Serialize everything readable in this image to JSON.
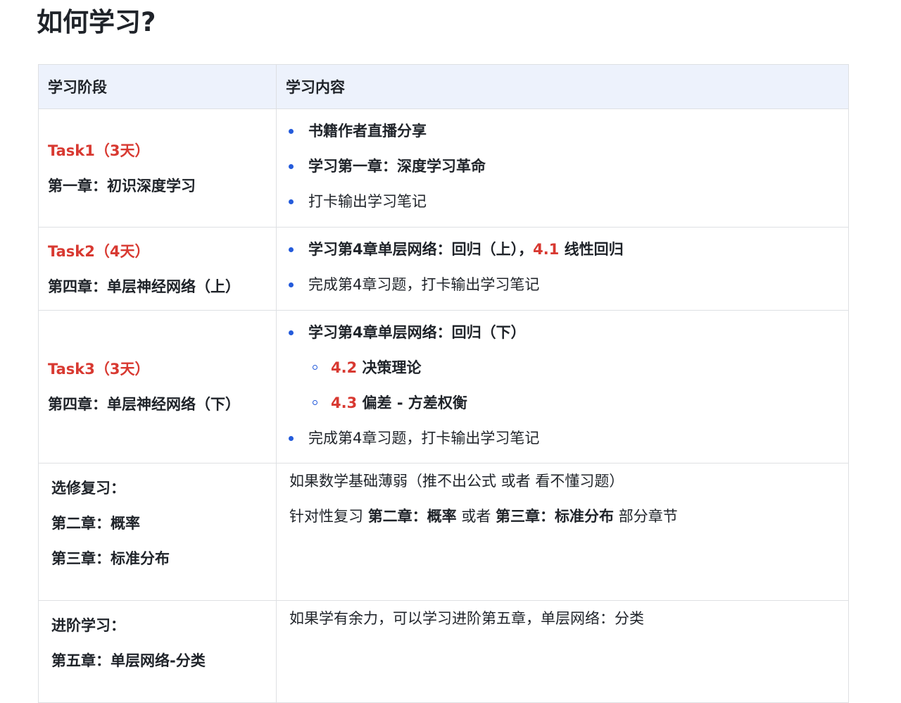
{
  "page": {
    "title": "如何学习?"
  },
  "table": {
    "headers": [
      "学习阶段",
      "学习内容"
    ],
    "rows": [
      {
        "stage": {
          "task": "Task1（3天）",
          "chapter": "第一章：初识深度学习"
        },
        "items": [
          {
            "text": "书籍作者直播分享",
            "bold": true
          },
          {
            "text": "学习第一章：深度学习革命",
            "bold": true
          },
          {
            "text": "打卡输出学习笔记",
            "bold": false
          }
        ]
      },
      {
        "stage": {
          "task": "Task2（4天）",
          "chapter": "第四章：单层神经网络（上）"
        },
        "items": [
          {
            "prefix": "学习第4章单层网络：回归（上），",
            "highlight": "4.1",
            "suffix": " 线性回归"
          },
          {
            "text": "完成第4章习题，打卡输出学习笔记",
            "bold": false
          }
        ]
      },
      {
        "stage": {
          "task": "Task3（3天）",
          "chapter": "第四章：单层神经网络（下）"
        },
        "items": [
          {
            "text": "学习第4章单层网络：回归（下）",
            "bold": true
          },
          {
            "highlight": "4.2",
            "suffix": " 决策理论",
            "sub": true
          },
          {
            "highlight": "4.3",
            "suffix": " 偏差 - 方差权衡",
            "sub": true
          },
          {
            "text": "完成第4章习题，打卡输出学习笔记",
            "bold": false
          }
        ]
      },
      {
        "stage": {
          "title": "选修复习：",
          "lines": [
            "第二章：概率",
            "第三章：标准分布"
          ]
        },
        "content": {
          "line1": "如果数学基础薄弱（推不出公式 或者 看不懂习题）",
          "line2": {
            "part1": "针对性复习 ",
            "bold1": "第二章：概率",
            "part2": " 或者 ",
            "bold2": "第三章：标准分布",
            "part3": " 部分章节"
          }
        }
      },
      {
        "stage": {
          "title": "进阶学习：",
          "lines": [
            "第五章：单层网络-分类"
          ]
        },
        "content": {
          "line1": "如果学有余力，可以学习进阶第五章，单层网络：分类"
        }
      }
    ]
  },
  "colors": {
    "accent_red": "#d83931",
    "bullet_blue": "#245bdb",
    "header_bg": "#edf2fc",
    "border": "#dee0e3"
  }
}
